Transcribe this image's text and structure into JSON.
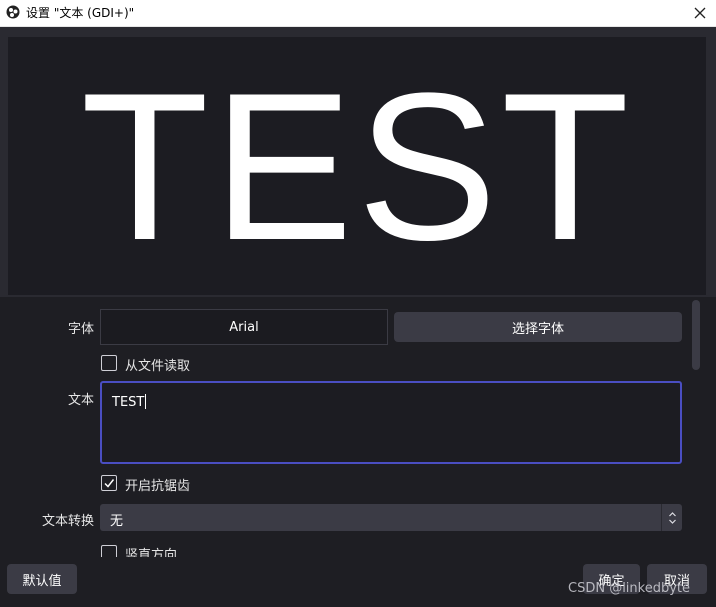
{
  "window": {
    "title": "设置 \"文本 (GDI+)\"",
    "logo_icon": "obs-logo-icon",
    "close_icon": "close-icon"
  },
  "preview": {
    "text": "TEST"
  },
  "properties": {
    "font": {
      "label": "字体",
      "value": "Arial",
      "button_label": "选择字体"
    },
    "read_from_file": {
      "label": "从文件读取",
      "checked": false
    },
    "text": {
      "label": "文本",
      "value": "TEST"
    },
    "antialiasing": {
      "label": "开启抗锯齿",
      "checked": true
    },
    "text_transform": {
      "label": "文本转换",
      "value": "无"
    },
    "vertical": {
      "label": "竖直方向",
      "checked": false
    }
  },
  "buttons": {
    "defaults": "默认值",
    "ok": "确定",
    "cancel": "取消"
  },
  "watermark": "CSDN @linkedbyte",
  "colors": {
    "background": "#1e1e23",
    "preview_bg": "#1c1c22",
    "button_bg": "#3b3b45",
    "focus_border": "#4a4ec2"
  }
}
